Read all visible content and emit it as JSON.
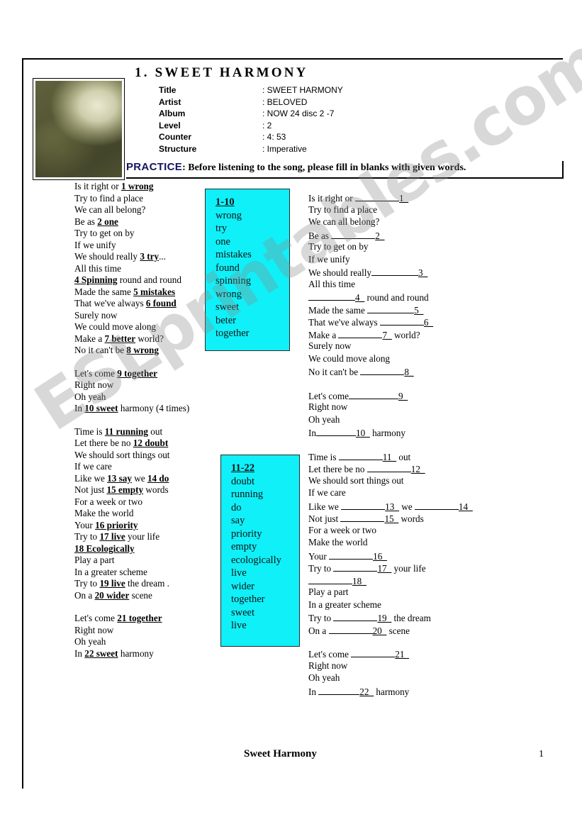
{
  "document": {
    "title": "1. SWEET HARMONY",
    "watermark": "ESLprintables.com",
    "accent_cyan": "#0FF0F8",
    "practice_label_color": "#151560"
  },
  "header": {
    "photo_alt": "artist-portrait",
    "meta": [
      {
        "label": "Title",
        "value": ": SWEET HARMONY"
      },
      {
        "label": "Artist",
        "value": ": BELOVED"
      },
      {
        "label": "Album",
        "value": ": NOW 24 disc 2 -7"
      },
      {
        "label": "Level",
        "value": ": 2"
      },
      {
        "label": "Counter",
        "value": ": 4: 53"
      },
      {
        "label": "Structure",
        "value": ": Imperative"
      }
    ]
  },
  "practice": {
    "label": "PRACTICE",
    "instruction": ": Before listening to the song,  please fill in blanks with given words."
  },
  "answer_key_lyrics": {
    "stanzas": [
      {
        "lines": [
          [
            {
              "t": "Is it right or ",
              "b": false
            },
            {
              "t": "1 wrong",
              "b": true
            }
          ],
          [
            {
              "t": "Try to find a place",
              "b": false
            }
          ],
          [
            {
              "t": "We can all belong?",
              "b": false
            }
          ],
          [
            {
              "t": "Be as ",
              "b": false
            },
            {
              "t": "2 one",
              "b": true
            }
          ],
          [
            {
              "t": "Try to get on by",
              "b": false
            }
          ],
          [
            {
              "t": "If we unify",
              "b": false
            }
          ],
          [
            {
              "t": "We should really ",
              "b": false
            },
            {
              "t": "3 try",
              "b": true
            },
            {
              "t": "...",
              "b": false
            }
          ],
          [
            {
              "t": "All this time",
              "b": false
            }
          ],
          [
            {
              "t": "4 Spinning",
              "b": true
            },
            {
              "t": " round and round",
              "b": false
            }
          ],
          [
            {
              "t": "Made the same ",
              "b": false
            },
            {
              "t": "5 mistakes",
              "b": true
            }
          ],
          [
            {
              "t": "That we've always ",
              "b": false
            },
            {
              "t": "6 found",
              "b": true
            }
          ],
          [
            {
              "t": "Surely now",
              "b": false
            }
          ],
          [
            {
              "t": "We could move along",
              "b": false
            }
          ],
          [
            {
              "t": "Make a ",
              "b": false
            },
            {
              "t": "7 better",
              "b": true
            },
            {
              "t": " world?",
              "b": false
            }
          ],
          [
            {
              "t": "No it can't be ",
              "b": false
            },
            {
              "t": "8 wrong",
              "b": true
            }
          ]
        ]
      },
      {
        "lines": [
          [
            {
              "t": "Let's come ",
              "b": false
            },
            {
              "t": "9 together",
              "b": true
            }
          ],
          [
            {
              "t": "Right now",
              "b": false
            }
          ],
          [
            {
              "t": "Oh yeah",
              "b": false
            }
          ],
          [
            {
              "t": "In ",
              "b": false
            },
            {
              "t": "10 sweet",
              "b": true
            },
            {
              "t": " harmony (4 times)",
              "b": false
            }
          ]
        ]
      },
      {
        "lines": [
          [
            {
              "t": "Time is ",
              "b": false
            },
            {
              "t": "11 running",
              "b": true
            },
            {
              "t": " out",
              "b": false
            }
          ],
          [
            {
              "t": "Let there be no ",
              "b": false
            },
            {
              "t": "12 doubt",
              "b": true
            }
          ],
          [
            {
              "t": "We should sort things out",
              "b": false
            }
          ],
          [
            {
              "t": "If we care",
              "b": false
            }
          ],
          [
            {
              "t": "Like we ",
              "b": false
            },
            {
              "t": "13 say",
              "b": true
            },
            {
              "t": " we ",
              "b": false
            },
            {
              "t": "14 do",
              "b": true
            }
          ],
          [
            {
              "t": "Not just ",
              "b": false
            },
            {
              "t": "15 empty",
              "b": true
            },
            {
              "t": " words",
              "b": false
            }
          ],
          [
            {
              "t": "For a week or two",
              "b": false
            }
          ],
          [
            {
              "t": "Make the world",
              "b": false
            }
          ],
          [
            {
              "t": "Your ",
              "b": false
            },
            {
              "t": "16 priority",
              "b": true
            }
          ],
          [
            {
              "t": "Try to ",
              "b": false
            },
            {
              "t": "17 live",
              "b": true
            },
            {
              "t": " your life",
              "b": false
            }
          ],
          [
            {
              "t": "18 Ecologically",
              "b": true
            }
          ],
          [
            {
              "t": "Play a part",
              "b": false
            }
          ],
          [
            {
              "t": "In a greater scheme",
              "b": false
            }
          ],
          [
            {
              "t": "Try to ",
              "b": false
            },
            {
              "t": "19 live",
              "b": true
            },
            {
              "t": " the dream .",
              "b": false
            }
          ],
          [
            {
              "t": "On a ",
              "b": false
            },
            {
              "t": "20 wider",
              "b": true
            },
            {
              "t": " scene",
              "b": false
            }
          ]
        ]
      },
      {
        "lines": [
          [
            {
              "t": "Let's come ",
              "b": false
            },
            {
              "t": "21 together",
              "b": true
            }
          ],
          [
            {
              "t": "Right now",
              "b": false
            }
          ],
          [
            {
              "t": "Oh yeah",
              "b": false
            }
          ],
          [
            {
              "t": "In ",
              "b": false
            },
            {
              "t": "22 sweet",
              "b": true
            },
            {
              "t": " harmony",
              "b": false
            }
          ]
        ]
      }
    ]
  },
  "blank_lyrics": {
    "stanzas": [
      {
        "lines": [
          [
            {
              "t": "Is it right or "
            },
            {
              "blank": 62,
              "n": "1_"
            }
          ],
          [
            {
              "t": "Try to find a place"
            }
          ],
          [
            {
              "t": "We can all belong?"
            }
          ],
          [
            {
              "t": "Be as "
            },
            {
              "blank": 62,
              "n": "2_"
            }
          ],
          [
            {
              "t": "Try to get on by"
            }
          ],
          [
            {
              "t": "If we unify"
            }
          ],
          [
            {
              "t": "We should really"
            },
            {
              "blank": 66,
              "n": "3_"
            }
          ],
          [
            {
              "t": "All this time"
            }
          ],
          [
            {
              "t": ""
            },
            {
              "blank": 66,
              "n": "4_"
            },
            {
              "t": " round and round"
            }
          ],
          [
            {
              "t": "Made the same "
            },
            {
              "blank": 66,
              "n": "5_"
            }
          ],
          [
            {
              "t": "That we've always "
            },
            {
              "blank": 62,
              "n": "6_"
            }
          ],
          [
            {
              "t": "Make a "
            },
            {
              "blank": 62,
              "n": "7_"
            },
            {
              "t": " world?"
            }
          ],
          [
            {
              "t": "Surely now"
            }
          ],
          [
            {
              "t": "We could move along"
            }
          ],
          [
            {
              "t": "No it can't be "
            },
            {
              "blank": 62,
              "n": "8_"
            }
          ]
        ]
      },
      {
        "lines": [
          [
            {
              "t": "Let's come"
            },
            {
              "blank": 70,
              "n": "9_"
            }
          ],
          [
            {
              "t": "Right now"
            }
          ],
          [
            {
              "t": "Oh yeah"
            }
          ],
          [
            {
              "t": "In"
            },
            {
              "blank": 56,
              "n": "10_"
            },
            {
              "t": " harmony"
            }
          ]
        ]
      },
      {
        "lines": [
          [
            {
              "t": "Time is "
            },
            {
              "blank": 62,
              "n": "11_"
            },
            {
              "t": " out"
            }
          ],
          [
            {
              "t": "Let there be no "
            },
            {
              "blank": 62,
              "n": "12_"
            }
          ],
          [
            {
              "t": "We should sort things out"
            }
          ],
          [
            {
              "t": "If we care"
            }
          ],
          [
            {
              "t": "Like we "
            },
            {
              "blank": 62,
              "n": "13_"
            },
            {
              "t": " we "
            },
            {
              "blank": 62,
              "n": "14_"
            }
          ],
          [
            {
              "t": "Not just "
            },
            {
              "blank": 62,
              "n": "15_"
            },
            {
              "t": " words"
            }
          ],
          [
            {
              "t": "For a  week or two"
            }
          ],
          [
            {
              "t": "Make the world"
            }
          ],
          [
            {
              "t": "Your "
            },
            {
              "blank": 62,
              "n": "16_"
            }
          ],
          [
            {
              "t": "Try to "
            },
            {
              "blank": 62,
              "n": "17_"
            },
            {
              "t": " your life"
            }
          ],
          [
            {
              "t": ""
            },
            {
              "blank": 62,
              "n": "18_"
            }
          ],
          [
            {
              "t": "Play a part"
            }
          ],
          [
            {
              "t": "In a greater scheme"
            }
          ],
          [
            {
              "t": "Try to "
            },
            {
              "blank": 62,
              "n": "19_"
            },
            {
              "t": " the dream"
            }
          ],
          [
            {
              "t": "On a "
            },
            {
              "blank": 62,
              "n": "20_"
            },
            {
              "t": " scene"
            }
          ]
        ]
      },
      {
        "lines": [
          [
            {
              "t": "Let's come "
            },
            {
              "blank": 62,
              "n": "21_"
            }
          ],
          [
            {
              "t": "Right now"
            }
          ],
          [
            {
              "t": "Oh yeah"
            }
          ],
          [
            {
              "t": "In "
            },
            {
              "blank": 58,
              "n": "22_"
            },
            {
              "t": " harmony"
            }
          ]
        ]
      }
    ]
  },
  "word_banks": [
    {
      "title": "1-10",
      "words": [
        "wrong",
        "try",
        "one",
        "mistakes",
        "found",
        "spinning",
        "wrong",
        "sweet",
        "beter",
        "together"
      ]
    },
    {
      "title": "11-22",
      "words": [
        "doubt",
        "running",
        "do",
        "say",
        "priority",
        "empty",
        "ecologically",
        "live",
        "wider",
        "together",
        "sweet",
        "live"
      ]
    }
  ],
  "footer": {
    "title": "Sweet Harmony",
    "page": "1"
  }
}
